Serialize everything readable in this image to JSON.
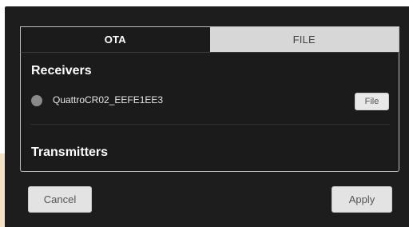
{
  "tabs": [
    {
      "label": "OTA",
      "active": true
    },
    {
      "label": "FILE",
      "active": false
    }
  ],
  "receivers": {
    "title": "Receivers",
    "items": [
      {
        "name": "QuattroCR02_EEFE1EE3",
        "status_color": "#8a8a8a",
        "action_label": "File"
      }
    ]
  },
  "transmitters": {
    "title": "Transmitters"
  },
  "footer": {
    "cancel_label": "Cancel",
    "apply_label": "Apply"
  },
  "colors": {
    "dialog_bg": "#1d1d1d",
    "active_tab_bg": "#1b1b1b",
    "inactive_tab_bg": "#d7d7d7",
    "button_bg": "#e3e3e3"
  }
}
